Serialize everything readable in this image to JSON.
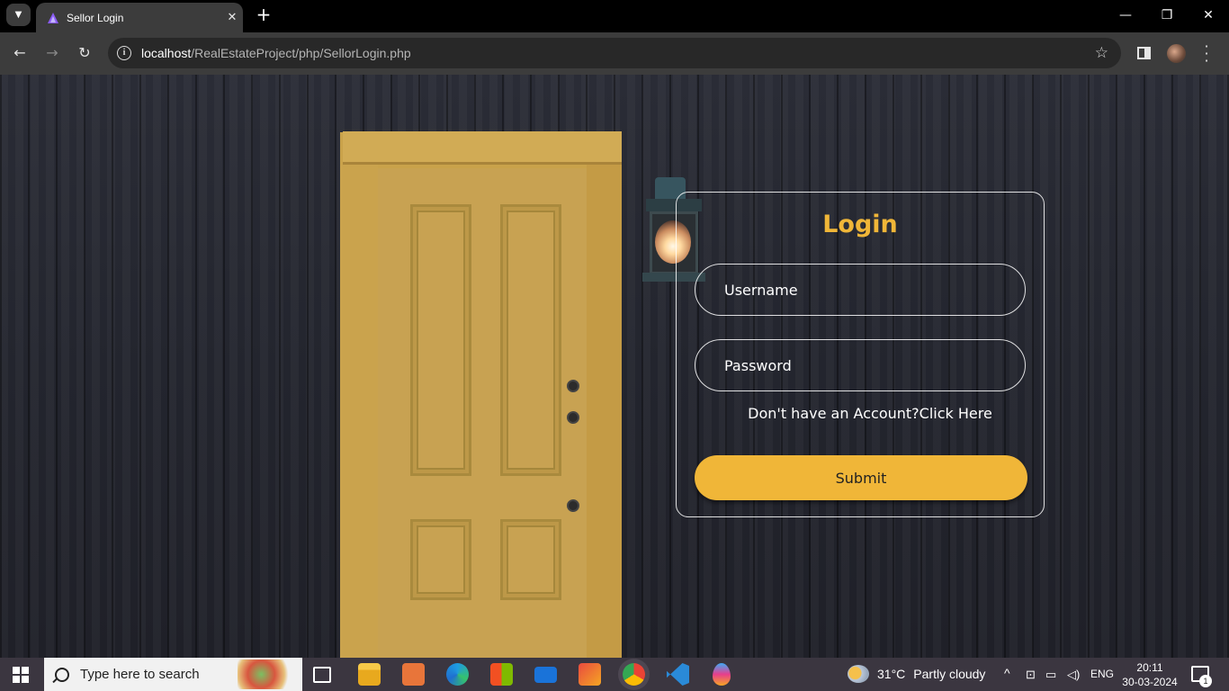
{
  "browser": {
    "tab": {
      "title": "Sellor Login",
      "favicon": "app-logo-icon"
    },
    "url": {
      "host": "localhost",
      "path": "/RealEstateProject/php/SellorLogin.php"
    },
    "icons": [
      "back-icon",
      "forward-icon",
      "reload-icon",
      "site-info-icon",
      "star-icon",
      "side-panel-icon",
      "profile-avatar",
      "menu-icon"
    ]
  },
  "login": {
    "title": "Login",
    "username_placeholder": "Username",
    "password_placeholder": "Password",
    "signup_prompt": "Don't have an Account?",
    "signup_link": "Click Here",
    "submit_label": "Submit"
  },
  "colors": {
    "accent": "#f0b638",
    "border": "#ffffff",
    "chrome": "#3c3c3c"
  },
  "taskbar": {
    "search_placeholder": "Type here to search",
    "weather": {
      "temp": "31°C",
      "condition": "Partly cloudy"
    },
    "language": "ENG",
    "time": "20:11",
    "date": "30-03-2024",
    "notifications": "1",
    "apps": [
      "task-view-icon",
      "file-explorer-icon",
      "app-icon",
      "edge-icon",
      "store-icon",
      "mail-icon",
      "paint-icon",
      "chrome-icon",
      "vscode-icon",
      "drop-icon"
    ]
  }
}
